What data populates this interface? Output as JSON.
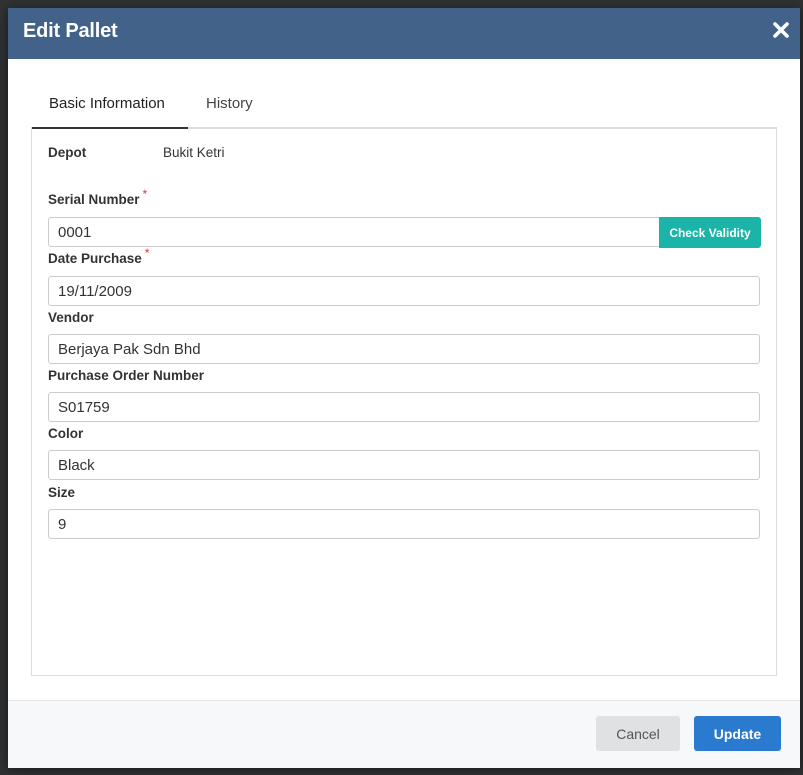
{
  "modal": {
    "title": "Edit Pallet"
  },
  "tabs": [
    {
      "label": "Basic Information",
      "active": true
    },
    {
      "label": "History",
      "active": false
    }
  ],
  "depot": {
    "label": "Depot",
    "value": "Bukit Ketri"
  },
  "fields": {
    "serial_number": {
      "label": "Serial Number",
      "value": "0001",
      "required": true
    },
    "date_purchase": {
      "label": "Date Purchase",
      "value": "19/11/2009",
      "required": true
    },
    "vendor": {
      "label": "Vendor",
      "value": "Berjaya Pak Sdn Bhd",
      "required": false
    },
    "purchase_order_number": {
      "label": "Purchase Order Number",
      "value": "S01759",
      "required": false
    },
    "color": {
      "label": "Color",
      "value": "Black",
      "required": false
    },
    "size": {
      "label": "Size",
      "value": "9",
      "required": false
    }
  },
  "required_marker": "*",
  "check_validity_label": "Check Validity",
  "footer": {
    "cancel_label": "Cancel",
    "update_label": "Update"
  },
  "colors": {
    "header_bg": "#42628a",
    "accent_teal": "#1ab5a8",
    "primary_blue": "#2a7ad0",
    "required_red": "#e03131"
  },
  "icons": {
    "close": "close-icon"
  }
}
